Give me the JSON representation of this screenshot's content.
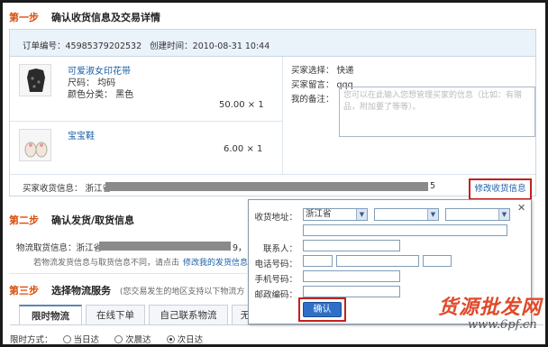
{
  "step1": {
    "num": "第一步",
    "title": "确认收货信息及交易详情"
  },
  "order": {
    "order_no": "订单编号：45985379202532",
    "created": "创建时间：2010-08-31 10:44"
  },
  "items": [
    {
      "name": "可爱淑女印花带",
      "size": "尺码：  均码",
      "color": "颜色分类：  黑色",
      "price": "50.00 × 1"
    },
    {
      "name": "宝宝鞋",
      "price": "6.00 × 1"
    }
  ],
  "buyer": {
    "choice": "买家选择：  快递",
    "message": "买家留言：  qqq",
    "note_label": "我的备注：",
    "note_placeholder": "您可以在此输入您想管理买家的信息（比如：有赠品，附加要了等等）。"
  },
  "address": {
    "label": "买家收货信息：  浙江省",
    "tail": "5",
    "modify_label": "修改收货信息"
  },
  "step2": {
    "num": "第二步",
    "title": "确认发货/取货信息",
    "pickup_label": "物流取货信息：浙江省",
    "pickup_tail": "9，",
    "hint": "若物流发货信息与取货信息不同，请点击",
    "hint_link": "修改我的发货信息"
  },
  "step3": {
    "num": "第三步",
    "title": "选择物流服务",
    "desc": "(您交易发生的地区支持以下物流方"
  },
  "tabs": [
    "限时物流",
    "在线下单",
    "自己联系物流",
    "无"
  ],
  "time_options": {
    "label": "限时方式：",
    "options": [
      "当日达",
      "次晨达",
      "次日达"
    ],
    "selected": "次日达"
  },
  "popup": {
    "addr_label": "收货地址：",
    "province": "浙江省",
    "contact_label": "联系人：",
    "phone_label": "电话号码：",
    "mobile_label": "手机号码：",
    "zip_label": "邮政编码：",
    "confirm_label": "确认",
    "close": "✕"
  },
  "watermark": {
    "cn": "货源批发网",
    "url": "www.6pf.cn"
  },
  "colors": {
    "accent": "#d94e0d",
    "link": "#1b5fa8",
    "highlight": "#c3201e",
    "button": "#2f6fc7"
  }
}
